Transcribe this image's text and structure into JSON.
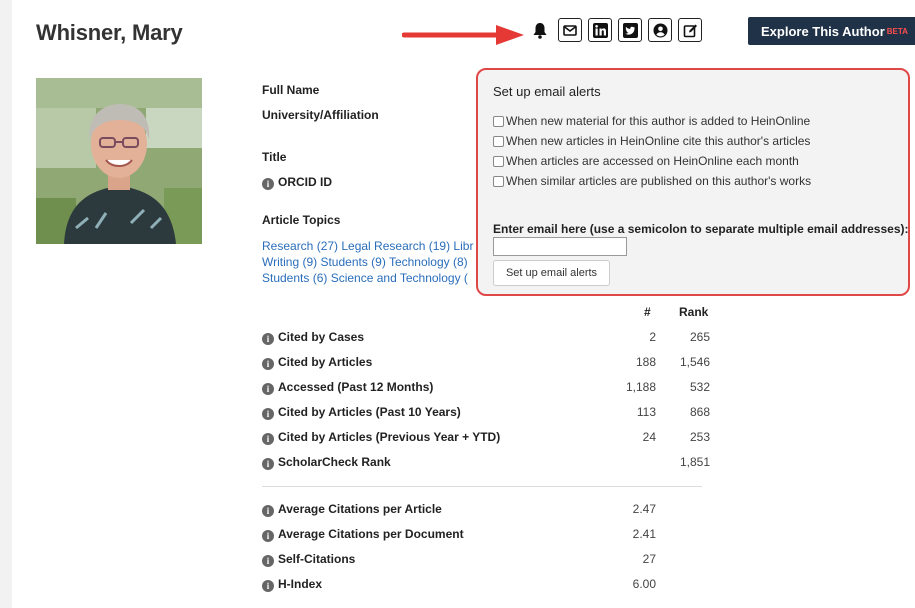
{
  "author": {
    "name": "Whisner, Mary"
  },
  "toolbar": {
    "icons": [
      "share-icon",
      "bell-icon",
      "envelope-icon",
      "linkedin-icon",
      "twitter-icon",
      "user-circle-icon",
      "edit-icon"
    ],
    "explore_label": "Explore This Author",
    "beta_label": "BETA"
  },
  "profile": {
    "full_name_label": "Full Name",
    "affiliation_label": "University/Affiliation",
    "title_label": "Title",
    "orcid_label": "ORCID ID",
    "topics_label": "Article Topics",
    "topics_lines": [
      "Research (27) Legal Research (19) Libr",
      "Writing (9) Students (9) Technology (8)",
      "Students (6) Science and Technology ("
    ]
  },
  "email_alerts": {
    "heading": "Set up email alerts",
    "options": [
      "When new material for this author is added to HeinOnline",
      "When new articles in HeinOnline cite this author's articles",
      "When articles are accessed on HeinOnline each month",
      "When similar articles are published on this author's works"
    ],
    "email_label": "Enter email here (use a semicolon to separate multiple email addresses):",
    "email_value": "",
    "button_label": "Set up email alerts"
  },
  "stats": {
    "col_count": "#",
    "col_rank": "Rank",
    "rows": [
      {
        "name": "Cited by Cases",
        "num": "2",
        "rank": "265"
      },
      {
        "name": "Cited by Articles",
        "num": "188",
        "rank": "1,546"
      },
      {
        "name": "Accessed (Past 12 Months)",
        "num": "1,188",
        "rank": "532"
      },
      {
        "name": "Cited by Articles (Past 10 Years)",
        "num": "113",
        "rank": "868"
      },
      {
        "name": "Cited by Articles (Previous Year + YTD)",
        "num": "24",
        "rank": "253"
      },
      {
        "name": "ScholarCheck Rank",
        "num": "",
        "rank": "1,851"
      }
    ],
    "rows2": [
      {
        "name": "Average Citations per Article",
        "num": "2.47"
      },
      {
        "name": "Average Citations per Document",
        "num": "2.41"
      },
      {
        "name": "Self-Citations",
        "num": "27"
      },
      {
        "name": "H-Index",
        "num": "6.00"
      }
    ]
  },
  "colors": {
    "accent": "#e04848",
    "nav": "#1f3247",
    "link": "#2a6ebb"
  }
}
